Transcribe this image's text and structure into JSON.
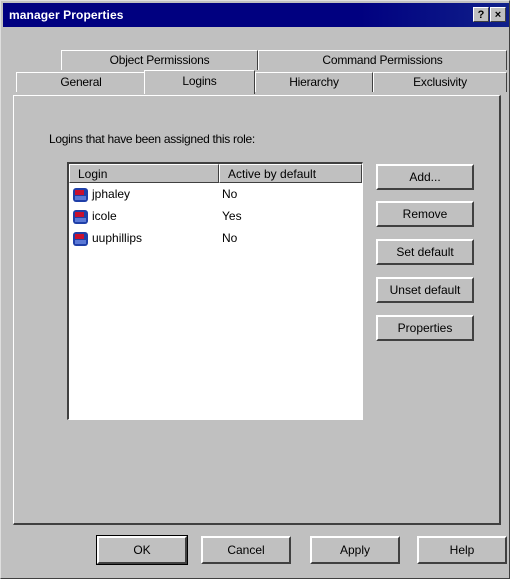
{
  "window": {
    "title": "manager Properties",
    "help_glyph": "?",
    "close_glyph": "×"
  },
  "tabs": {
    "row_back": [
      {
        "label": "Object Permissions"
      },
      {
        "label": "Command Permissions"
      }
    ],
    "row_front": [
      {
        "label": "General"
      },
      {
        "label": "Logins",
        "active": true
      },
      {
        "label": "Hierarchy"
      },
      {
        "label": "Exclusivity"
      }
    ]
  },
  "panel": {
    "label": "Logins that have been assigned this role:"
  },
  "list": {
    "columns": [
      "Login",
      "Active by default"
    ],
    "rows": [
      {
        "login": "jphaley",
        "active": "No"
      },
      {
        "login": "icole",
        "active": "Yes"
      },
      {
        "login": "uuphillips",
        "active": "No"
      }
    ],
    "icon": "user-icon"
  },
  "side_buttons": [
    "Add...",
    "Remove",
    "Set default",
    "Unset default",
    "Properties"
  ],
  "bottom_buttons": [
    "OK",
    "Cancel",
    "Apply",
    "Help"
  ],
  "colors": {
    "titlebar": "#000080",
    "face": "#c0c0c0",
    "list_bg": "#ffffff",
    "icon_red": "#c8102e",
    "icon_blue": "#1f3fa8"
  }
}
